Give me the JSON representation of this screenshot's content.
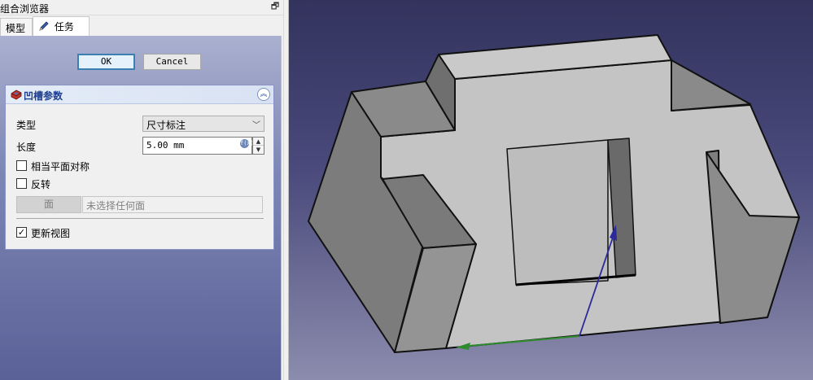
{
  "combo_view": {
    "title": "组合浏览器",
    "float_icon": "restore-window-icon"
  },
  "tabs": [
    {
      "label": "模型"
    },
    {
      "label": "任务",
      "icon": "pencil-icon"
    }
  ],
  "dialog": {
    "ok_label": "OK",
    "cancel_label": "Cancel"
  },
  "pocket_params": {
    "title": "凹槽参数",
    "icon": "pocket-feature-icon",
    "collapse_icon": "collapse-up-icon",
    "type_label": "类型",
    "type_value": "尺寸标注",
    "length_label": "长度",
    "length_value": "5.00 mm",
    "expression_icon": "expression-icon",
    "symmetric_label": "相当平面对称",
    "symmetric_checked": false,
    "reversed_label": "反转",
    "reversed_checked": false,
    "face_button_label": "面",
    "face_placeholder": "未选择任何面",
    "refresh_view_label": "更新视图",
    "refresh_view_checked": true
  },
  "colors": {
    "accent_blue": "#1e3f8f",
    "viewport_top": "#33335e",
    "viewport_bottom": "#8c8cae",
    "axis_x": "#2e8b2e",
    "axis_y": "#2a2a9a"
  }
}
